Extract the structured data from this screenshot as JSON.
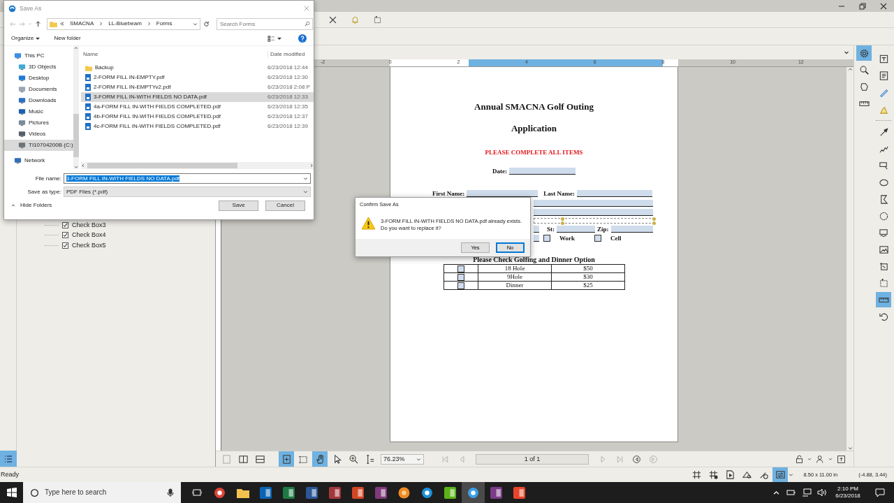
{
  "ruler_labels": [
    "-2",
    "0",
    "2",
    "4",
    "6",
    "8",
    "10",
    "12"
  ],
  "fields_panel": {
    "items": [
      {
        "label": "Check Box3",
        "checked": true
      },
      {
        "label": "Check Box4",
        "checked": true
      },
      {
        "label": "Check Box5",
        "checked": true
      }
    ]
  },
  "document": {
    "title": "Annual SMACNA Golf Outing",
    "subtitle": "Application",
    "notice": "PLEASE COMPLETE ALL ITEMS",
    "date_label": "Date:",
    "first_name_label": "First Name:",
    "last_name_label": "Last Name:",
    "st_label": "St:",
    "zip_label": "Zip:",
    "phone_options": [
      {
        "label": "Work",
        "checked": false
      },
      {
        "label": "Cell",
        "checked": false
      }
    ],
    "options_heading": "Please Check Golfing and Dinner Option",
    "options": [
      {
        "label": "18 Hole",
        "price": "$50",
        "checked": false
      },
      {
        "label": "9Hole",
        "price": "$30",
        "checked": false
      },
      {
        "label": "Dinner",
        "price": "$25",
        "checked": false
      }
    ]
  },
  "right_tools": {
    "column_1": [
      {
        "kind": "gear",
        "selected": true
      },
      {
        "kind": "search",
        "selected": false
      },
      {
        "kind": "shape",
        "selected": false
      },
      {
        "kind": "ruler",
        "selected": false
      }
    ],
    "column_2_top": [
      {
        "kind": "text-box",
        "selected": false
      },
      {
        "kind": "note",
        "selected": false
      },
      {
        "kind": "pen",
        "selected": false
      },
      {
        "kind": "highlighter",
        "selected": false
      }
    ],
    "column_2_bottom": [
      {
        "kind": "arrow",
        "selected": false
      },
      {
        "kind": "zigzag",
        "selected": false
      },
      {
        "kind": "callout",
        "selected": false
      },
      {
        "kind": "ellipse",
        "selected": false
      },
      {
        "kind": "polygon",
        "selected": false
      },
      {
        "kind": "cloud",
        "selected": false
      },
      {
        "kind": "stamp",
        "selected": false
      },
      {
        "kind": "image",
        "selected": false
      },
      {
        "kind": "crop",
        "selected": false
      },
      {
        "kind": "dashed-rectangle",
        "selected": false
      },
      {
        "kind": "ruler",
        "selected": true
      },
      {
        "kind": "undo",
        "selected": false
      }
    ]
  },
  "page_nav": {
    "zoom": "76.23%",
    "page": "1 of 1",
    "tools_left": [
      {
        "kind": "single-page",
        "selected": false,
        "disabled": true
      },
      {
        "kind": "split-vertical",
        "selected": false,
        "disabled": false
      },
      {
        "kind": "split-horizontal",
        "selected": false,
        "disabled": false
      },
      {
        "kind": "page-select",
        "selected": true,
        "disabled": false
      },
      {
        "kind": "page-snapshot",
        "selected": false,
        "disabled": false
      },
      {
        "kind": "hand",
        "selected": true,
        "disabled": false
      },
      {
        "kind": "pointer",
        "selected": false,
        "disabled": false
      },
      {
        "kind": "zoom",
        "selected": false,
        "disabled": false
      },
      {
        "kind": "text-select",
        "selected": false,
        "disabled": false
      }
    ],
    "nav_before": [
      {
        "kind": "first",
        "disabled": true
      },
      {
        "kind": "prev",
        "disabled": true
      }
    ],
    "nav_after": [
      {
        "kind": "next",
        "disabled": true
      },
      {
        "kind": "last",
        "disabled": true
      },
      {
        "kind": "back-circle",
        "disabled": false
      },
      {
        "kind": "forward-circle",
        "disabled": true
      }
    ],
    "tools_right": [
      {
        "kind": "lock",
        "disabled": false
      },
      {
        "kind": "person",
        "disabled": false
      },
      {
        "kind": "upload",
        "disabled": false
      }
    ]
  },
  "status_bar": {
    "text": "Ready",
    "tools": [
      {
        "kind": "grid",
        "selected": false
      },
      {
        "kind": "grid-snap",
        "selected": false
      },
      {
        "kind": "document-snap",
        "selected": false
      },
      {
        "kind": "markup-snap",
        "selected": false
      },
      {
        "kind": "reuse",
        "selected": false
      },
      {
        "kind": "sync",
        "selected": true
      }
    ],
    "page_size": "8.50 x 11.00 in",
    "coordinates": "(-4.88, 3.44)"
  },
  "save_dialog": {
    "title": "Save As",
    "path": [
      "SMACNA",
      "LL-Bluebeam",
      "Forms"
    ],
    "search": {
      "placeholder": "Search Forms"
    },
    "organize": "Organize",
    "new_folder": "New folder",
    "nav": [
      {
        "label": "This PC",
        "kind": "pc",
        "selected": false,
        "children": [
          {
            "label": "3D Objects",
            "kind": "cube",
            "selected": false
          },
          {
            "label": "Desktop",
            "kind": "desktop",
            "selected": false
          },
          {
            "label": "Documents",
            "kind": "documents",
            "selected": false
          },
          {
            "label": "Downloads",
            "kind": "downloads",
            "selected": false
          },
          {
            "label": "Music",
            "kind": "music",
            "selected": false
          },
          {
            "label": "Pictures",
            "kind": "pictures",
            "selected": false
          },
          {
            "label": "Videos",
            "kind": "videos",
            "selected": false
          },
          {
            "label": "TI10704200B (C:)",
            "kind": "drive",
            "selected": true
          }
        ]
      },
      {
        "label": "Network",
        "kind": "network",
        "selected": false
      }
    ],
    "columns": [
      "Name",
      "Date modified"
    ],
    "files": [
      {
        "name": "Backup",
        "date": "6/23/2018 12:44",
        "kind": "folder",
        "selected": false
      },
      {
        "name": "2-FORM FILL IN-EMPTY.pdf",
        "date": "6/23/2018 12:30",
        "kind": "pdf",
        "selected": false
      },
      {
        "name": "2-FORM FILL IN-EMPTYv2.pdf",
        "date": "6/23/2018 2:08 P",
        "kind": "pdf",
        "selected": false
      },
      {
        "name": "3-FORM FILL IN-WITH FIELDS NO DATA.pdf",
        "date": "6/23/2018 12:33",
        "kind": "pdf",
        "selected": true
      },
      {
        "name": "4a-FORM FILL IN-WITH FIELDS COMPLETED.pdf",
        "date": "6/23/2018 12:35",
        "kind": "pdf",
        "selected": false
      },
      {
        "name": "4b-FORM FILL IN-WITH FIELDS COMPLETED.pdf",
        "date": "6/23/2018 12:37",
        "kind": "pdf",
        "selected": false
      },
      {
        "name": "4c-FORM FILL IN-WITH FIELDS COMPLETED.pdf",
        "date": "6/23/2018 12:39",
        "kind": "pdf",
        "selected": false
      }
    ],
    "file_name_label": "File name:",
    "file_name": "3-FORM FILL IN-WITH FIELDS NO DATA.pdf",
    "type_label": "Save as type:",
    "type": "PDF Files (*.pdf)",
    "hide_folders": "Hide Folders",
    "buttons": [
      {
        "label": "Save"
      },
      {
        "label": "Cancel"
      }
    ]
  },
  "confirm_dialog": {
    "title": "Confirm Save As",
    "message": "3-FORM FILL IN-WITH FIELDS NO DATA.pdf already exists.\nDo you want to replace it?",
    "buttons": [
      {
        "label": "Yes",
        "focused": false
      },
      {
        "label": "No",
        "focused": true
      }
    ]
  },
  "taskbar": {
    "search_placeholder": "Type here to search",
    "apps": [
      {
        "kind": "ring",
        "color": "#db4437",
        "active": false
      },
      {
        "kind": "folder",
        "color": "#f2c14e",
        "active": false
      },
      {
        "kind": "tile",
        "color": "#0a64b4",
        "active": false
      },
      {
        "kind": "tile",
        "color": "#1d7a45",
        "active": false
      },
      {
        "kind": "tile",
        "color": "#2b5797",
        "active": false
      },
      {
        "kind": "tile",
        "color": "#a4373a",
        "active": false
      },
      {
        "kind": "tile",
        "color": "#d24726",
        "active": false
      },
      {
        "kind": "tile",
        "color": "#80397b",
        "active": false
      },
      {
        "kind": "flower",
        "color": "#f08a24",
        "active": false
      },
      {
        "kind": "ring",
        "color": "#1e90d8",
        "active": false
      },
      {
        "kind": "tile",
        "color": "#5bb318",
        "active": false
      },
      {
        "kind": "ring",
        "color": "#3aa0e8",
        "active": true
      },
      {
        "kind": "tile",
        "color": "#7a3b88",
        "active": false
      },
      {
        "kind": "tile",
        "color": "#e8452c",
        "active": false
      }
    ],
    "time": "2:10 PM",
    "date": "6/23/2018"
  }
}
